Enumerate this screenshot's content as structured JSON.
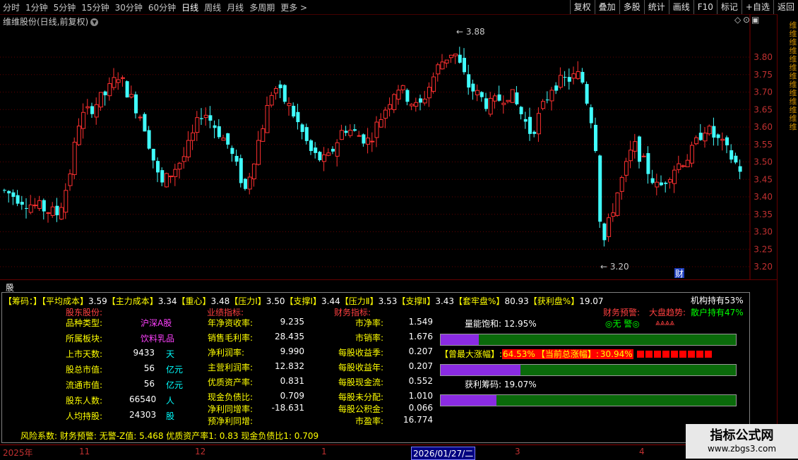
{
  "periods": {
    "items": [
      "分时",
      "1分钟",
      "5分钟",
      "15分钟",
      "30分钟",
      "60分钟",
      "日线",
      "周线",
      "月线",
      "多周期",
      "更多 >"
    ],
    "active_index": 6
  },
  "toolbar": {
    "items": [
      "复权",
      "叠加",
      "多股",
      "统计",
      "画线",
      "F10",
      "标记",
      "+自选",
      "返回"
    ]
  },
  "chart": {
    "title": "维维股份(日线,前复权)",
    "high_label": "3.88",
    "low_label": "3.20",
    "cai_label": "财",
    "price_ticks": [
      "3.80",
      "3.75",
      "3.70",
      "3.65",
      "3.60",
      "3.55",
      "3.50",
      "3.45",
      "3.40",
      "3.35",
      "3.30",
      "3.25",
      "3.20"
    ],
    "colors": {
      "up": "#ff3030",
      "down": "#40ffff",
      "grid": "#600000"
    }
  },
  "right_strip": {
    "text": "维维维维维维维维维维维维维"
  },
  "indicator": {
    "title": "股朋指标网",
    "row1": [
      {
        "k": "【筹码：】",
        "v": ""
      },
      {
        "k": "【平均成本】",
        "v": "3.59"
      },
      {
        "k": "【主力成本】",
        "v": "3.34"
      },
      {
        "k": "【重心】",
        "v": "3.48"
      },
      {
        "k": "【压力Ⅰ】",
        "v": "3.50"
      },
      {
        "k": "【支撑Ⅰ】",
        "v": "3.44"
      },
      {
        "k": "【压力Ⅱ】",
        "v": "3.53"
      },
      {
        "k": "【支撑Ⅱ】",
        "v": "3.43"
      },
      {
        "k": "【套牢盘%】",
        "v": "80.93"
      },
      {
        "k": "【获利盘%】",
        "v": "19.07"
      }
    ],
    "inst_hold": "机构持有53%",
    "retail_hold": "散户持有47%",
    "section_shareholder": "股东股份:",
    "section_perf": "业绩指标:",
    "section_fin": "财务指标:",
    "fin_warn": "财务预警:",
    "trend": "大盘趋势:",
    "no_warn": "◎无 警◎",
    "arrows": "⩓⩓⩓⩓",
    "shareholder": {
      "labels": [
        "品种类型:",
        "所属板块:",
        "上市天数:",
        "股总市值:",
        "流通市值:",
        "股东人数:",
        "人均持股:"
      ],
      "values": [
        "",
        "",
        "9433",
        "56",
        "56",
        "66540",
        "24303"
      ],
      "units": [
        "沪深A股",
        "饮料乳品",
        "天",
        "亿元",
        "亿元",
        "人",
        "股"
      ]
    },
    "perf": {
      "labels": [
        "年净资收率:",
        "销售毛利率:",
        "净利润率:",
        "主营利润率:",
        "优质资产率:",
        "现金负债比:",
        "净利同增率:",
        "预净利同增:"
      ],
      "values": [
        "9.235",
        "28.435",
        "9.990",
        "12.832",
        "0.831",
        "0.709",
        "-18.631",
        ""
      ]
    },
    "fin": {
      "labels": [
        "市净率:",
        "市销率:",
        "每股收益季:",
        "每股收益年:",
        "每股现金流:",
        "每股未分配:",
        "每股公积金:",
        "市盈率:"
      ],
      "values": [
        "1.549",
        "1.676",
        "0.207",
        "0.207",
        "0.552",
        "1.010",
        "0.066",
        "16.774"
      ]
    },
    "vol_sat": "量能饱和: 12.95%",
    "vol_sat_fraction": 0.13,
    "gain_label": "【曾最大涨幅】:",
    "gain_max": "64.53%",
    "gain_cur_label": "【当前总涨幅】:",
    "gain_cur": "30.94%",
    "bar2_fraction": 0.27,
    "profit_chips": "获利筹码: 19.07%",
    "bar3_fraction": 0.19,
    "footer": "风险系数: 财务预警: 无警-Z值: 5.468 优质资产率1: 0.83 现金负债比1: 0.709"
  },
  "time_axis": {
    "labels": [
      "2025年",
      "11",
      "12",
      "1",
      "2026/01/27/二",
      "3",
      "4"
    ]
  },
  "watermark": {
    "title": "指标公式网",
    "url": "www.zbgs3.com"
  }
}
